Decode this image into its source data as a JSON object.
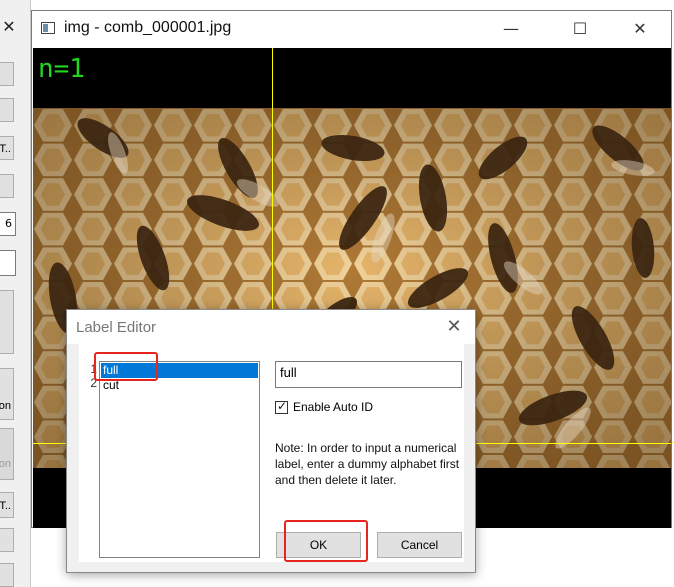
{
  "background_window": {
    "close_glyph": "✕",
    "buttons": [
      {
        "label": ""
      },
      {
        "label": ""
      },
      {
        "label": "T.."
      },
      {
        "label": ""
      },
      {
        "label": "6"
      },
      {
        "label": ""
      },
      {
        "label": ""
      },
      {
        "label": "on"
      },
      {
        "label": "on"
      },
      {
        "label": "T.."
      },
      {
        "label": ""
      },
      {
        "label": ""
      }
    ]
  },
  "image_window": {
    "title": "img - comb_000001.jpg",
    "minimize_glyph": "—",
    "maximize_glyph": "☐",
    "close_glyph": "✕",
    "counter_text": "n=1",
    "counter_color": "#22d622",
    "guide_color": "#ffff00"
  },
  "label_editor": {
    "title": "Label Editor",
    "close_glyph": "✕",
    "line_numbers": [
      "1",
      "2"
    ],
    "labels": [
      {
        "text": "full",
        "selected": true
      },
      {
        "text": "cut",
        "selected": false
      }
    ],
    "input_value": "full",
    "auto_id": {
      "checked": true,
      "label": "Enable Auto ID",
      "check_glyph": "✓"
    },
    "note": "Note: In order to input a numerical label, enter a dummy alphabet first and then delete it later.",
    "ok_label": "OK",
    "cancel_label": "Cancel"
  },
  "colors": {
    "highlight": "#e8251c",
    "selection": "#0078d7",
    "honey": "#d9a55a"
  }
}
